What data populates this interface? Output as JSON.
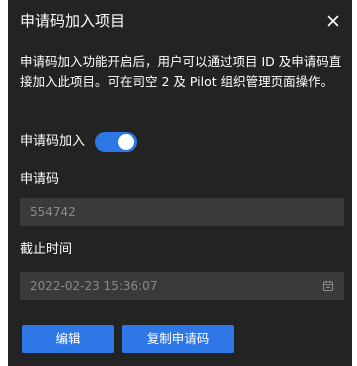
{
  "dialog": {
    "title": "申请码加入项目",
    "description": "申请码加入功能开启后，用户可以通过项目 ID 及申请码直接加入此项目。可在司空 2 及 Pilot 组织管理页面操作。",
    "toggle": {
      "label": "申请码加入",
      "enabled": true
    },
    "code": {
      "label": "申请码",
      "value": "554742"
    },
    "deadline": {
      "label": "截止时间",
      "value": "2022-02-23 15:36:07"
    },
    "buttons": {
      "edit": "编辑",
      "copy": "复制申请码"
    }
  },
  "colors": {
    "background": "#232323",
    "accent": "#2e77e6",
    "input_bg": "#3a3a3a",
    "muted_text": "#8a8a8a"
  },
  "icons": [
    "close-icon",
    "calendar-icon"
  ]
}
